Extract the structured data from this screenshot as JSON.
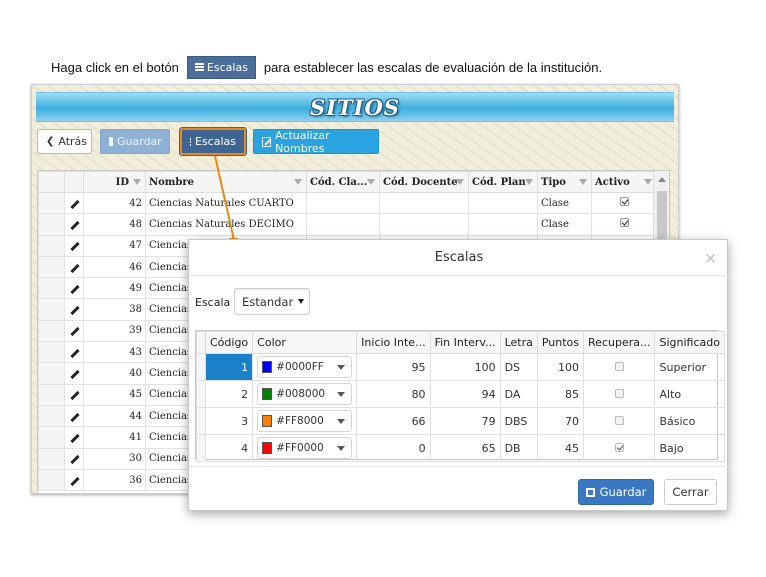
{
  "instruction": {
    "before": "Haga click en el botón",
    "button": "Escalas",
    "after": "para establecer las escalas de evaluación de la institución."
  },
  "app": {
    "banner": "SITIOS",
    "toolbar": {
      "back": "Atrás",
      "save": "Guardar",
      "scales": "Escalas",
      "update_names": "Actualizar Nombres"
    },
    "grid": {
      "columns": [
        "ID",
        "Nombre",
        "Cód. Cla...",
        "Cód. Docente",
        "Cód. Plan",
        "Tipo",
        "Activo"
      ],
      "rows": [
        {
          "id": "42",
          "nombre": "Ciencias Naturales CUARTO",
          "tipo": "Clase"
        },
        {
          "id": "48",
          "nombre": "Ciencias Naturales DECIMO",
          "tipo": "Clase"
        },
        {
          "id": "47",
          "nombre": "Ciencias",
          "tipo": ""
        },
        {
          "id": "46",
          "nombre": "Ciencias",
          "tipo": ""
        },
        {
          "id": "49",
          "nombre": "Ciencias",
          "tipo": ""
        },
        {
          "id": "38",
          "nombre": "Ciencias",
          "tipo": ""
        },
        {
          "id": "39",
          "nombre": "Ciencias",
          "tipo": ""
        },
        {
          "id": "43",
          "nombre": "Ciencias",
          "tipo": ""
        },
        {
          "id": "40",
          "nombre": "Ciencias",
          "tipo": ""
        },
        {
          "id": "45",
          "nombre": "Ciencias",
          "tipo": ""
        },
        {
          "id": "44",
          "nombre": "Ciencias",
          "tipo": ""
        },
        {
          "id": "41",
          "nombre": "Ciencias",
          "tipo": ""
        },
        {
          "id": "30",
          "nombre": "Ciencias",
          "tipo": ""
        },
        {
          "id": "36",
          "nombre": "Ciencias",
          "tipo": ""
        }
      ]
    }
  },
  "modal": {
    "title": "Escalas",
    "close": "×",
    "escala_label": "Escala",
    "escala_value": "Estandar",
    "columns": [
      "Código",
      "Color",
      "Inicio Inte...",
      "Fin Interv...",
      "Letra",
      "Puntos",
      "Recupera...",
      "Significado"
    ],
    "rows": [
      {
        "codigo": "1",
        "color": "#0000FF",
        "inicio": "95",
        "fin": "100",
        "letra": "DS",
        "puntos": "100",
        "recupera": false,
        "significado": "Superior"
      },
      {
        "codigo": "2",
        "color": "#008000",
        "inicio": "80",
        "fin": "94",
        "letra": "DA",
        "puntos": "85",
        "recupera": false,
        "significado": "Alto"
      },
      {
        "codigo": "3",
        "color": "#FF8000",
        "inicio": "66",
        "fin": "79",
        "letra": "DBS",
        "puntos": "70",
        "recupera": false,
        "significado": "Básico"
      },
      {
        "codigo": "4",
        "color": "#FF0000",
        "inicio": "0",
        "fin": "65",
        "letra": "DB",
        "puntos": "45",
        "recupera": true,
        "significado": "Bajo"
      }
    ],
    "save": "Guardar",
    "close_button": "Cerrar"
  },
  "colors": {
    "highlight_border": "#e48a1c",
    "primary": "#3a78c3",
    "selected_cell": "#1a80c8"
  }
}
